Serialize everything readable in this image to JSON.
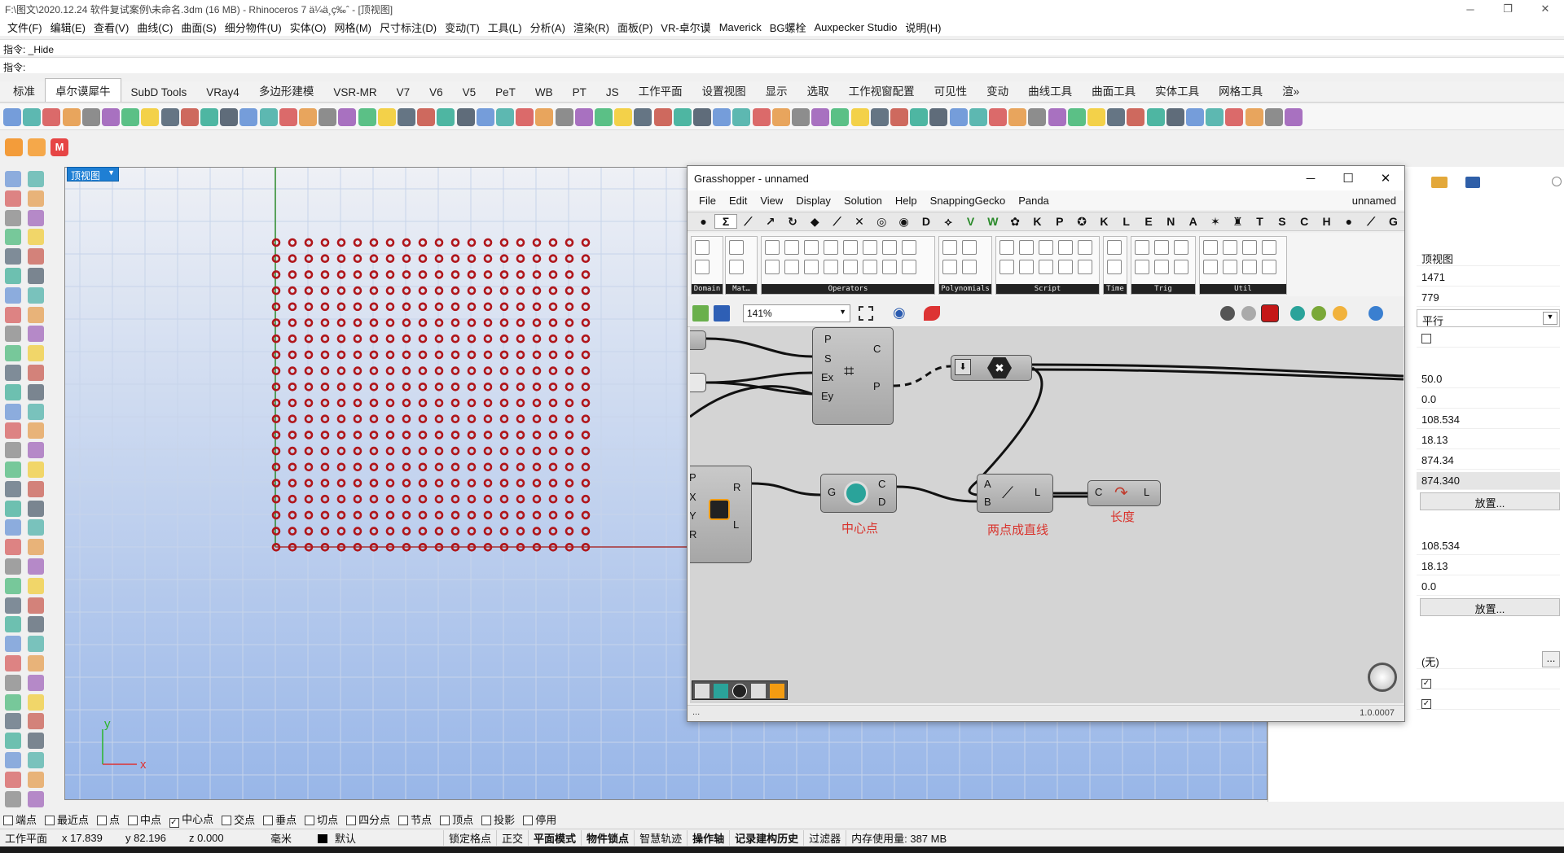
{
  "window": {
    "title": "F:\\图文\\2020.12.24 软件复试案例\\未命名.3dm (16 MB) - Rhinoceros 7 ä¼ä¸ç‰ˆ - [顶视图]",
    "minimize": "─",
    "restore": "❐",
    "close": "✕"
  },
  "menu": [
    "文件(F)",
    "编辑(E)",
    "查看(V)",
    "曲线(C)",
    "曲面(S)",
    "细分物件(U)",
    "实体(O)",
    "网格(M)",
    "尺寸标注(D)",
    "变动(T)",
    "工具(L)",
    "分析(A)",
    "渲染(R)",
    "面板(P)",
    "VR-卓尔谟",
    "Maverick",
    "BG螺栓",
    "Auxpecker Studio",
    "说明(H)"
  ],
  "command": {
    "history": "指令: _Hide",
    "prompt": "指令:"
  },
  "tabs": [
    "标准",
    "卓尔谟犀牛",
    "SubD Tools",
    "VRay4",
    "多边形建模",
    "VSR-MR",
    "V7",
    "V6",
    "V5",
    "PeT",
    "WB",
    "PT",
    "JS",
    "工作平面",
    "设置视图",
    "显示",
    "选取",
    "工作视窗配置",
    "可见性",
    "变动",
    "曲线工具",
    "曲面工具",
    "实体工具",
    "网格工具",
    "渲»"
  ],
  "active_tab": "卓尔谟犀牛",
  "viewport": {
    "name": "顶视图",
    "axis_x": "x",
    "axis_y": "y"
  },
  "properties": {
    "view_name": "顶视图",
    "width": "1471",
    "height": "779",
    "projection": "平行",
    "lens": "50.0",
    "rotation": "0.0",
    "cam_x": "108.534",
    "cam_y": "18.13",
    "cam_z": "874.34",
    "cam_z2": "874.340",
    "place_btn": "放置...",
    "tgt_x": "108.534",
    "tgt_y": "18.13",
    "tgt_z": "0.0",
    "place_btn2": "放置...",
    "wallpaper": "(无)",
    "more": "..."
  },
  "grasshopper": {
    "title": "Grasshopper - unnamed",
    "menu": [
      "File",
      "Edit",
      "View",
      "Display",
      "Solution",
      "Help",
      "SnappingGecko",
      "Panda"
    ],
    "doc_name": "unnamed",
    "tabs": [
      "●",
      "Σ",
      "⟋",
      "↗",
      "↻",
      "◆",
      "⟋",
      "✕",
      "◎",
      "◉",
      "D",
      "⟡",
      "V",
      "W",
      "✿",
      "K",
      "P",
      "✪",
      "K",
      "L",
      "E",
      "N",
      "A",
      "✶",
      "♜",
      "T",
      "S",
      "C",
      "H",
      "●",
      "⟋",
      "G"
    ],
    "ribbon_groups": [
      "Domain",
      "Mat…",
      "Operators",
      "Polynomials",
      "Script",
      "Time",
      "Trig",
      "Util"
    ],
    "zoom": "141%",
    "version": "1.0.0007",
    "status_left": "...",
    "components": {
      "rect": {
        "inputs": [
          "P",
          "S",
          "Ex",
          "Ey"
        ],
        "outputs": [
          "C",
          "P"
        ]
      },
      "area": {
        "inputs": [
          "G"
        ],
        "outputs": [
          "C",
          "D"
        ],
        "label": "中心点"
      },
      "line": {
        "inputs": [
          "A",
          "B"
        ],
        "outputs": [
          "L"
        ],
        "label": "两点成直线"
      },
      "length": {
        "inputs": [
          "C"
        ],
        "outputs": [
          "L"
        ],
        "label": "长度"
      },
      "rectangle2": {
        "inputs": [
          "P",
          "X",
          "Y",
          "R"
        ],
        "outputs": [
          "R",
          "L"
        ]
      }
    }
  },
  "osnaps": [
    {
      "label": "端点",
      "checked": false
    },
    {
      "label": "最近点",
      "checked": false
    },
    {
      "label": "点",
      "checked": false
    },
    {
      "label": "中点",
      "checked": false
    },
    {
      "label": "中心点",
      "checked": true
    },
    {
      "label": "交点",
      "checked": false
    },
    {
      "label": "垂点",
      "checked": false
    },
    {
      "label": "切点",
      "checked": false
    },
    {
      "label": "四分点",
      "checked": false
    },
    {
      "label": "节点",
      "checked": false
    },
    {
      "label": "顶点",
      "checked": false
    },
    {
      "label": "投影",
      "checked": false
    },
    {
      "label": "停用",
      "checked": false
    }
  ],
  "status": {
    "cplane": "工作平面",
    "x": "x 17.839",
    "y": "y 82.196",
    "z": "z 0.000",
    "unit": "毫米",
    "layer": "默认",
    "items": [
      "锁定格点",
      "正交",
      "平面模式",
      "物件锁点",
      "智慧轨迹",
      "操作轴",
      "记录建构历史",
      "过滤器",
      "内存使用量: 387 MB"
    ]
  },
  "colors": {
    "accent": "#1f7fd4",
    "point": "#b0161b",
    "label_red": "#d9322b"
  }
}
